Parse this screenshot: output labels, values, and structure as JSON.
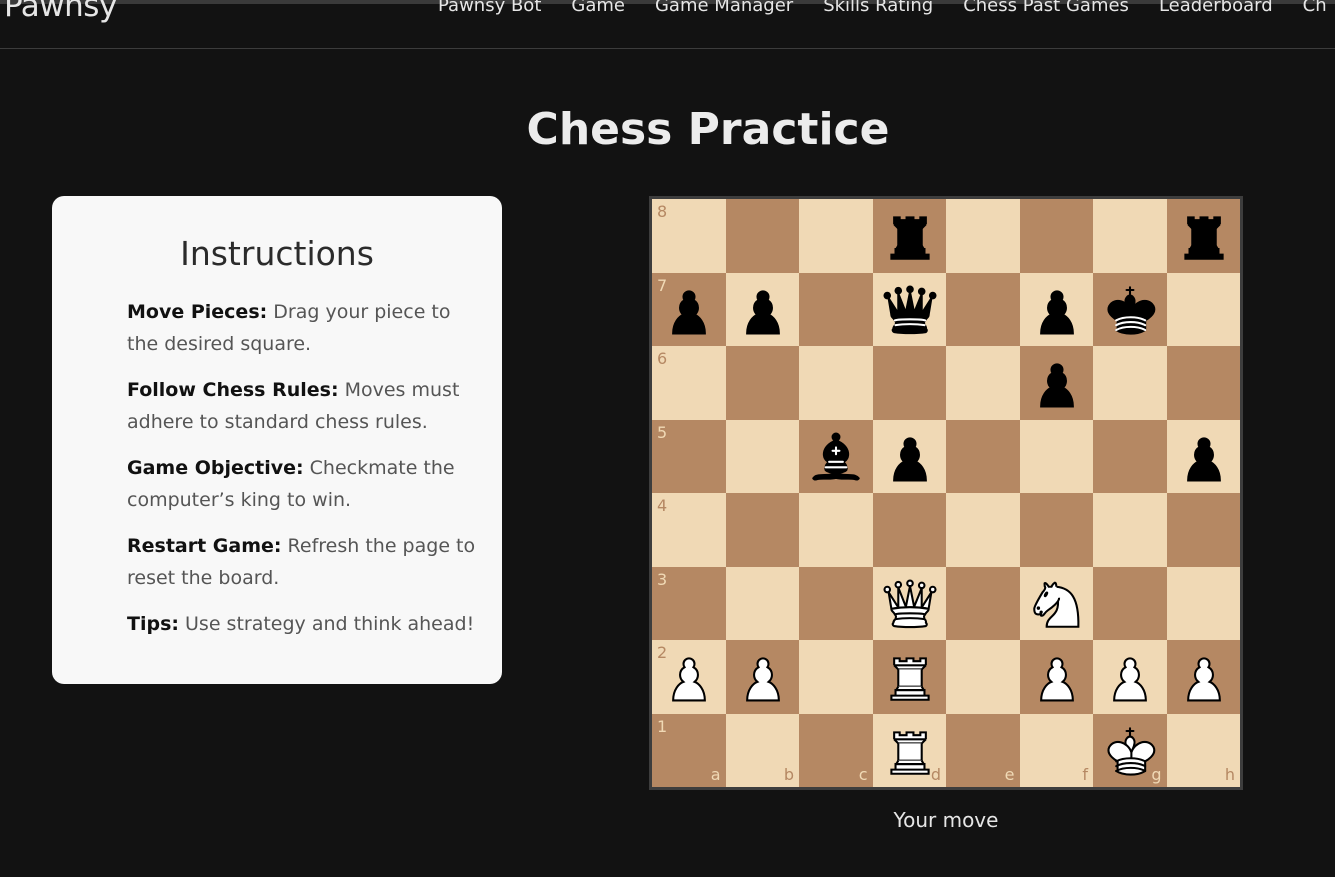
{
  "nav": {
    "brand": "Pawnsy",
    "links": [
      "Pawnsy Bot",
      "Game",
      "Game Manager",
      "Skills Rating",
      "Chess Past Games",
      "Leaderboard",
      "Ch"
    ]
  },
  "page_title": "Chess Practice",
  "instructions": {
    "title": "Instructions",
    "items": [
      {
        "label": "Move Pieces:",
        "text": " Drag your piece to the desired square."
      },
      {
        "label": "Follow Chess Rules:",
        "text": " Moves must adhere to standard chess rules."
      },
      {
        "label": "Game Objective:",
        "text": " Checkmate the computer’s king to win."
      },
      {
        "label": "Restart Game:",
        "text": " Refresh the page to reset the board."
      },
      {
        "label": "Tips:",
        "text": " Use strategy and think ahead!"
      }
    ]
  },
  "board": {
    "ranks": [
      "8",
      "7",
      "6",
      "5",
      "4",
      "3",
      "2",
      "1"
    ],
    "files": [
      "a",
      "b",
      "c",
      "d",
      "e",
      "f",
      "g",
      "h"
    ],
    "colors": {
      "light": "#f0d9b5",
      "dark": "#b58863"
    },
    "pieces": {
      "d8": "bR",
      "h8": "bR",
      "a7": "bP",
      "b7": "bP",
      "d7": "bQ",
      "f7": "bP",
      "g7": "bK",
      "f6": "bP",
      "c5": "bB",
      "d5": "bP",
      "h5": "bP",
      "d3": "wQ",
      "f3": "wN",
      "a2": "wP",
      "b2": "wP",
      "d2": "wR",
      "f2": "wP",
      "g2": "wP",
      "h2": "wP",
      "d1": "wR",
      "g1": "wK"
    }
  },
  "status": "Your move"
}
